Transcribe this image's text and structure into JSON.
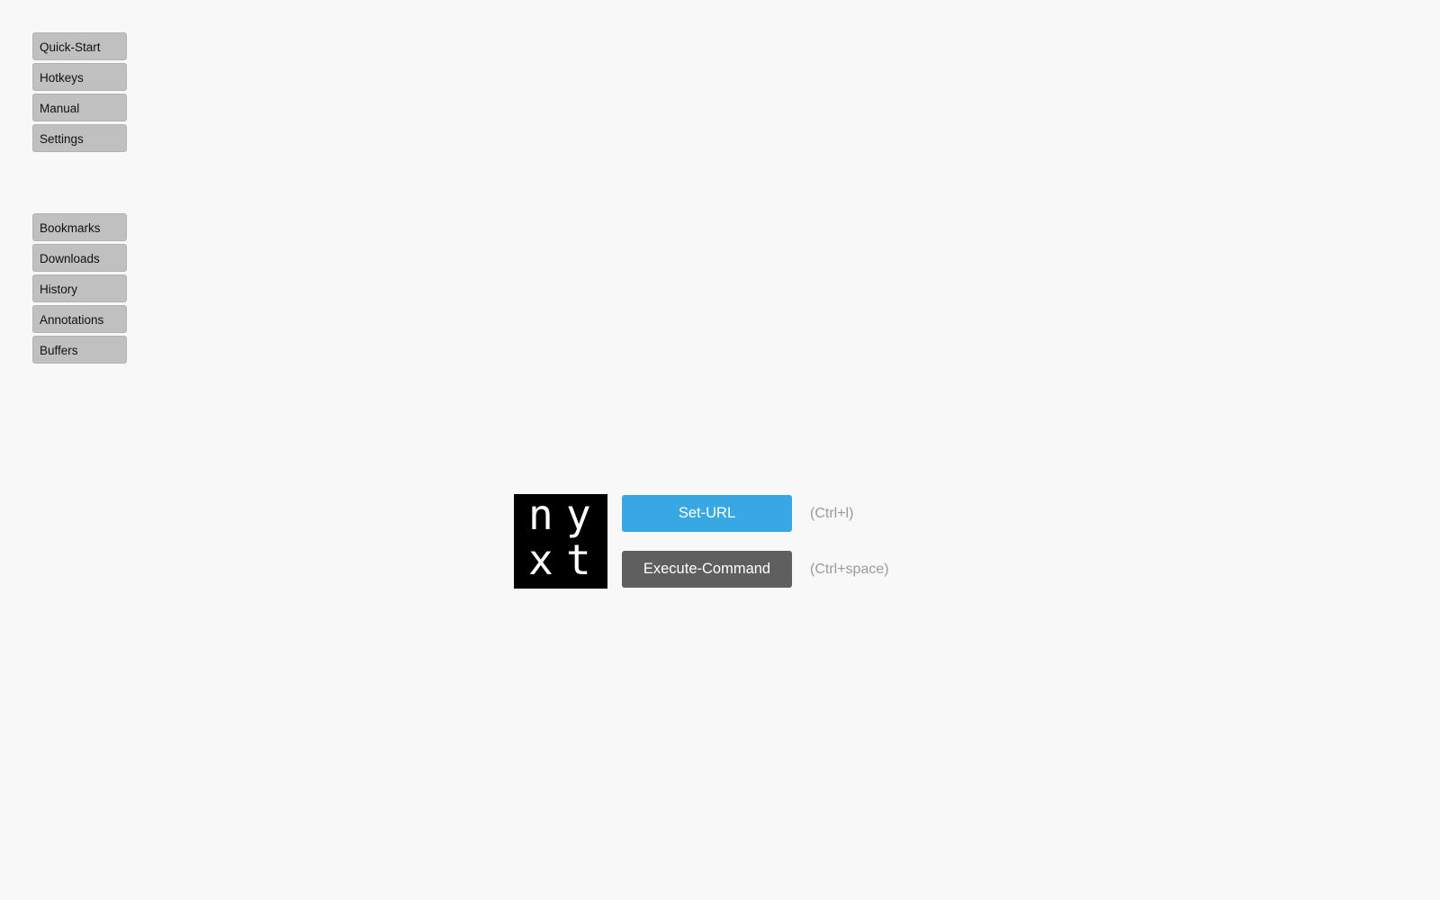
{
  "sidebar": {
    "top_items": [
      {
        "label": "Quick-Start"
      },
      {
        "label": "Hotkeys"
      },
      {
        "label": "Manual"
      },
      {
        "label": "Settings"
      }
    ],
    "bottom_items": [
      {
        "label": "Bookmarks"
      },
      {
        "label": "Downloads"
      },
      {
        "label": "History"
      },
      {
        "label": "Annotations"
      },
      {
        "label": "Buffers"
      }
    ]
  },
  "logo": {
    "letters": [
      "n",
      "y",
      "x",
      "t"
    ]
  },
  "commands": [
    {
      "label": "Set-URL",
      "hint": "(Ctrl+l)",
      "color": "#37a8e4"
    },
    {
      "label": "Execute-Command",
      "hint": "(Ctrl+space)",
      "color": "#5f5f5f"
    }
  ],
  "colors": {
    "background": "#f8f8f8",
    "nav_button": "#c0c0c0",
    "hint_text": "#9b9b9b"
  }
}
